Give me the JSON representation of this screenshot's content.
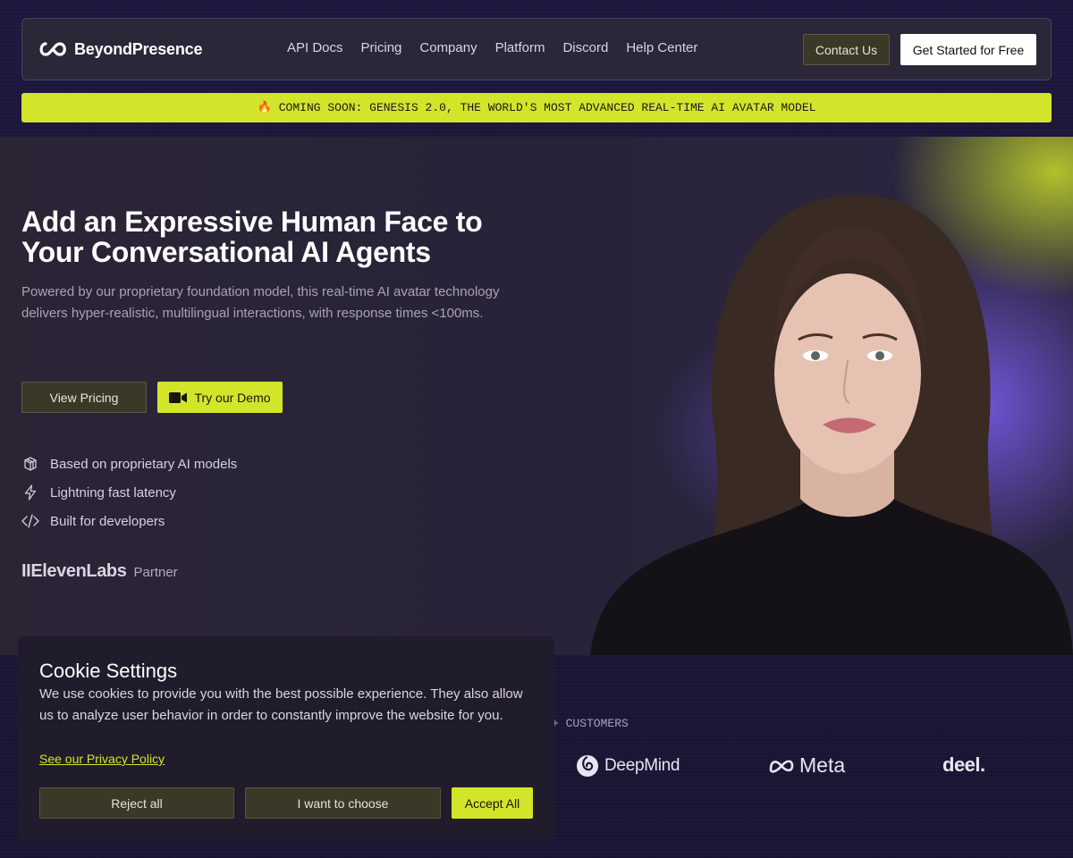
{
  "brand": {
    "name": "BeyondPresence",
    "logo_icon": "infinity-link-icon"
  },
  "nav": {
    "links": [
      "API Docs",
      "Pricing",
      "Company",
      "Platform",
      "Discord",
      "Help Center"
    ],
    "contact_label": "Contact Us",
    "cta_label": "Get Started for Free"
  },
  "announcement": {
    "icon": "fire-emoji",
    "text": "COMING SOON: GENESIS 2.0, THE WORLD'S MOST ADVANCED REAL-TIME AI AVATAR MODEL"
  },
  "hero": {
    "title": "Add an Expressive Human Face to Your Conversational AI Agents",
    "subtitle": "Powered by our proprietary foundation model, this real-time AI avatar technology delivers hyper-realistic, multilingual interactions, with response times <100ms.",
    "pricing_label": "View Pricing",
    "demo_label": "Try our Demo",
    "demo_icon": "video-camera-icon",
    "features": [
      {
        "icon": "cube-icon",
        "text": "Based on proprietary AI models"
      },
      {
        "icon": "lightning-icon",
        "text": "Lightning fast latency"
      },
      {
        "icon": "code-icon",
        "text": "Built for developers"
      }
    ],
    "partner": {
      "logo": "IIElevenLabs",
      "label": "Partner"
    }
  },
  "customers": {
    "label": "+ CUSTOMERS",
    "logos": [
      "DeepMind",
      "Meta",
      "deel."
    ]
  },
  "cookie": {
    "title": "Cookie Settings",
    "text": "We use cookies to provide you with the best possible experience. They also allow us to analyze user behavior in order to constantly improve the website for you.",
    "policy_link": "See our Privacy Policy",
    "reject_label": "Reject all",
    "choose_label": "I want to choose",
    "accept_label": "Accept All"
  },
  "colors": {
    "accent": "#d3e52b",
    "background": "#1d1638",
    "panel": "#2b2638"
  }
}
